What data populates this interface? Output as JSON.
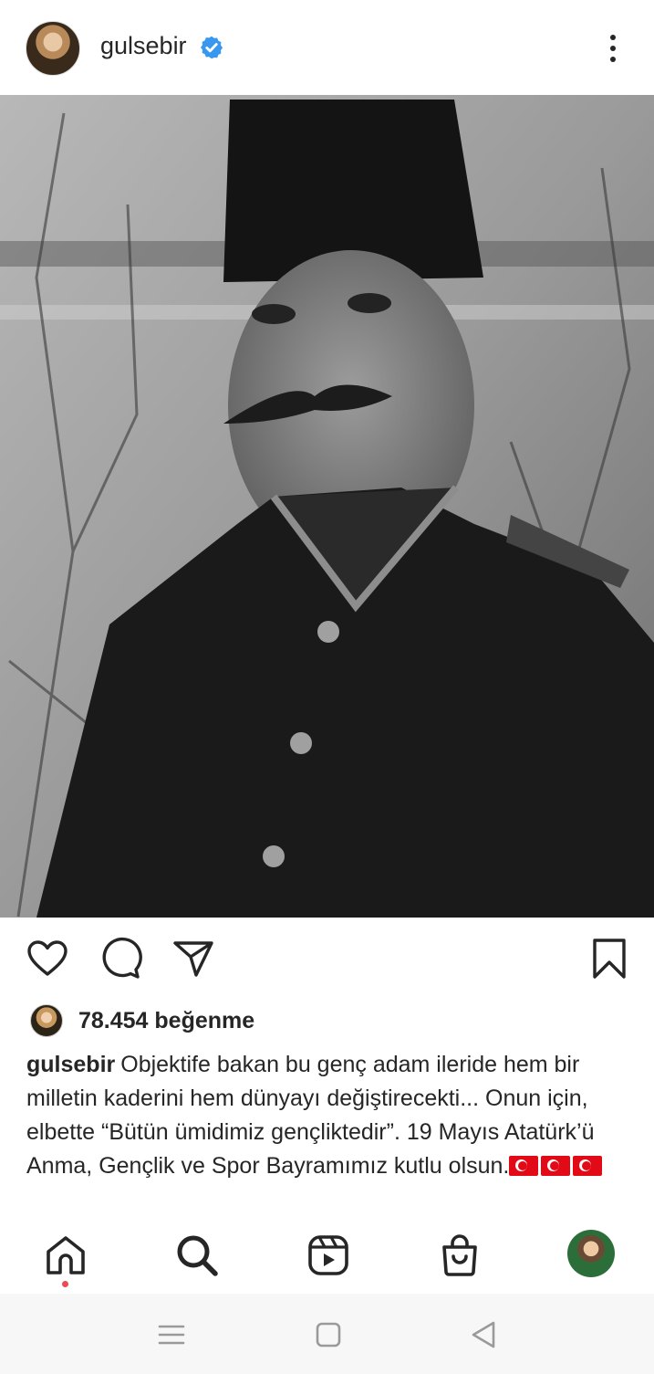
{
  "post": {
    "username": "gulsebir",
    "verified": true,
    "likes_text": "78.454 beğenme",
    "caption_user": "gulsebir",
    "caption_text": "Objektife bakan bu genç adam ileride hem bir milletin kaderini hem dünyayı değiştirecekti... Onun için, elbette “Bütün ümidimiz gençliktedir”. 19 Mayıs Atatürk’ü Anma, Gençlik ve Spor Bayramımız kutlu olsun.",
    "caption_flags": 3
  },
  "colors": {
    "text": "#262626",
    "verified_blue": "#3897f0",
    "notification_dot": "#ed4956",
    "flag_red": "#e30a17"
  },
  "icons": {
    "header": [
      "verified-badge-icon",
      "more-options-icon"
    ],
    "actions": [
      "heart-icon",
      "comment-icon",
      "share-icon",
      "bookmark-icon"
    ],
    "bottom_nav": [
      "home-icon",
      "search-icon",
      "reels-icon",
      "shop-icon",
      "profile-avatar"
    ],
    "system_nav": [
      "menu-icon",
      "home-square-icon",
      "back-icon"
    ]
  }
}
